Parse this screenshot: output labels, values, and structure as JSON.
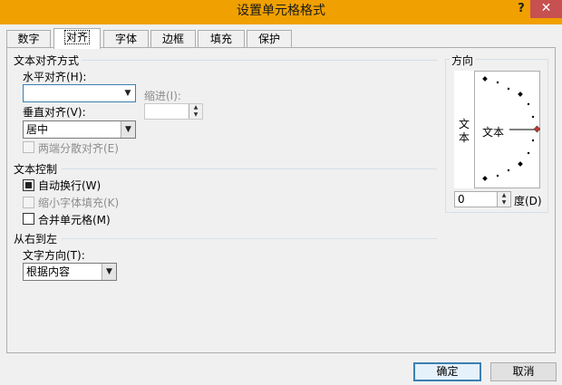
{
  "window": {
    "title": "设置单元格格式",
    "help_label": "?",
    "close_label": "✕"
  },
  "tabs": [
    {
      "label": "数字"
    },
    {
      "label": "对齐"
    },
    {
      "label": "字体"
    },
    {
      "label": "边框"
    },
    {
      "label": "填充"
    },
    {
      "label": "保护"
    }
  ],
  "active_tab": "对齐",
  "text_alignment": {
    "group_label": "文本对齐方式",
    "horizontal_label": "水平对齐(H):",
    "horizontal_value": "",
    "indent_label": "缩进(I):",
    "indent_value": "",
    "vertical_label": "垂直对齐(V):",
    "vertical_value": "居中",
    "justify_distributed_label": "两端分散对齐(E)",
    "justify_distributed_checked": false
  },
  "text_control": {
    "group_label": "文本控制",
    "wrap_text_label": "自动换行(W)",
    "wrap_text_checked": true,
    "shrink_to_fit_label": "缩小字体填充(K)",
    "shrink_to_fit_checked": false,
    "merge_cells_label": "合并单元格(M)",
    "merge_cells_checked": false
  },
  "right_to_left": {
    "group_label": "从右到左",
    "direction_label": "文字方向(T):",
    "direction_value": "根据内容"
  },
  "orientation": {
    "group_label": "方向",
    "vertical_text": [
      "文",
      "本"
    ],
    "dial_text": "文本",
    "degrees_value": "0",
    "degrees_label": "度(D)"
  },
  "buttons": {
    "ok": "确定",
    "cancel": "取消"
  },
  "colors": {
    "title_bar": "#f0a000",
    "close_button": "#c75050",
    "dial_marker": "#c0392b"
  }
}
